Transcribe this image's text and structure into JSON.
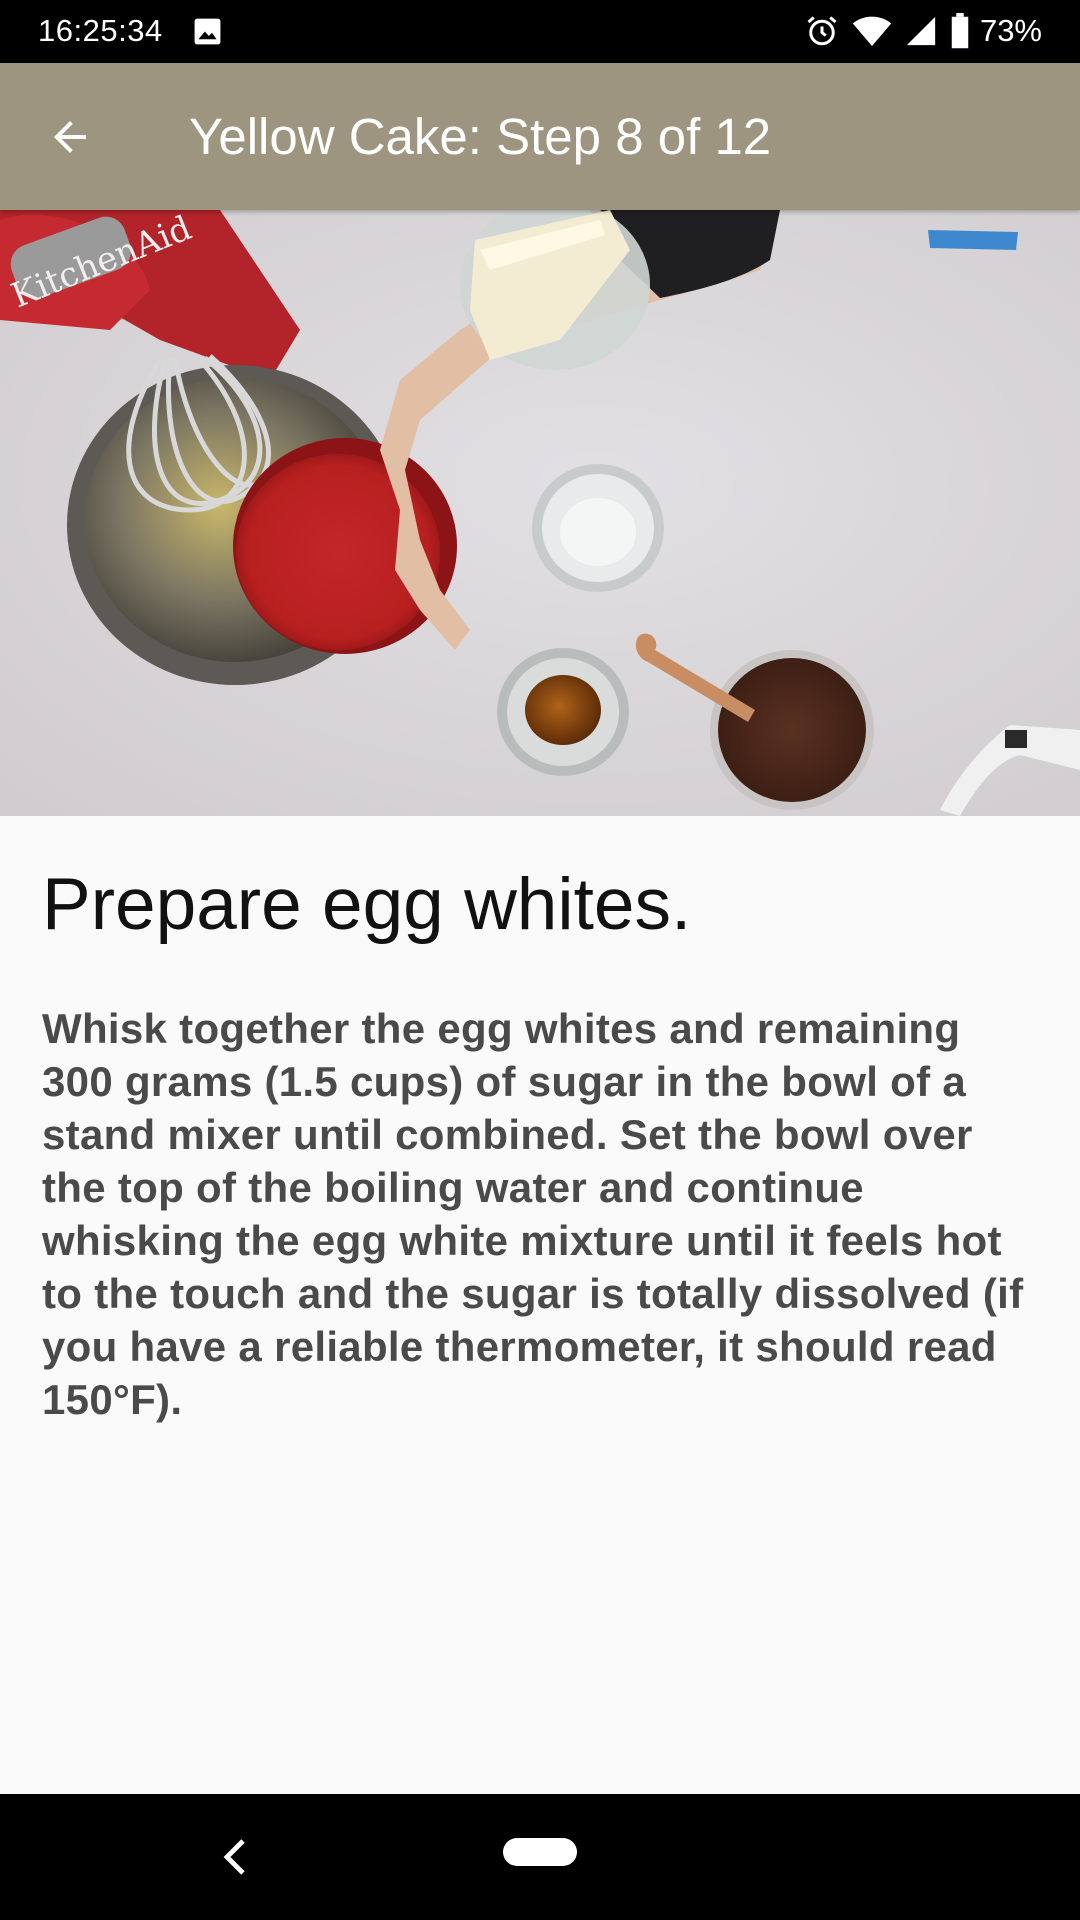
{
  "status_bar": {
    "time": "16:25:34",
    "battery_percent": "73%",
    "icons": [
      "gallery-icon",
      "alarm-icon",
      "wifi-icon",
      "signal-icon",
      "battery-icon"
    ]
  },
  "app_bar": {
    "title": "Yellow Cake: Step 8 of 12",
    "back_icon": "arrow-back-icon",
    "background_color": "#9e9581"
  },
  "hero_image": {
    "image_label": "KitchenAid"
  },
  "step": {
    "title": "Prepare egg whites.",
    "body": "Whisk together the egg whites and remaining 300 grams (1.5 cups) of sugar in the bowl of a stand mixer until combined. Set the bowl over the top of the boiling water and continue whisking the egg white mixture until it feels hot to the touch and the sugar is totally dissolved (if you have a reliable thermometer, it should read 150°F)."
  },
  "nav_bar": {
    "back_icon": "nav-back-icon",
    "home_icon": "nav-home-pill"
  }
}
